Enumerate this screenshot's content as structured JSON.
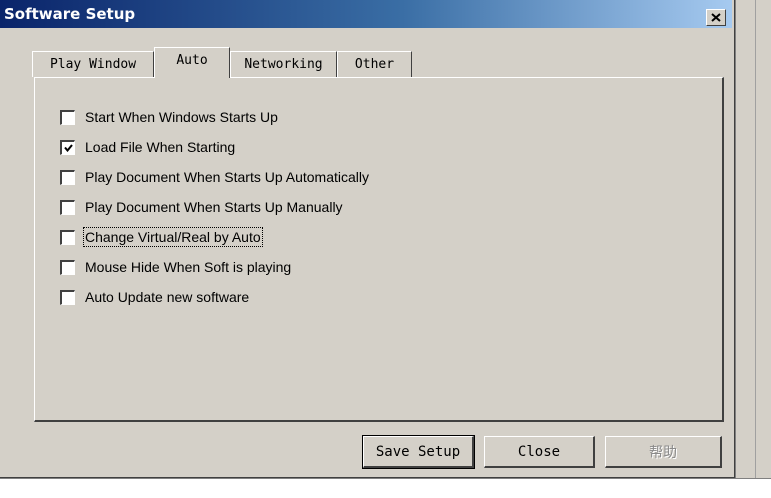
{
  "window": {
    "title": "Software Setup",
    "close_label": "×"
  },
  "tabs": [
    {
      "label": "Play Window",
      "active": false
    },
    {
      "label": "Auto",
      "active": true
    },
    {
      "label": "Networking",
      "active": false
    },
    {
      "label": "Other",
      "active": false
    }
  ],
  "options": [
    {
      "label": "Start When Windows Starts Up",
      "checked": false
    },
    {
      "label": "Load File When Starting",
      "checked": true
    },
    {
      "label": "Play Document When Starts Up Automatically",
      "checked": false
    },
    {
      "label": "Play Document When Starts Up Manually",
      "checked": false
    },
    {
      "label": "Change Virtual/Real by Auto",
      "checked": false,
      "focused": true
    },
    {
      "label": "Mouse Hide When Soft is playing",
      "checked": false
    },
    {
      "label": "Auto Update new software",
      "checked": false
    }
  ],
  "buttons": {
    "save": "Save Setup",
    "close": "Close",
    "help": "帮助"
  },
  "colors": {
    "face": "#d4d0c8",
    "title_start": "#0a246a",
    "title_end": "#a6caf0",
    "disabled_text": "#8a8a8a"
  }
}
